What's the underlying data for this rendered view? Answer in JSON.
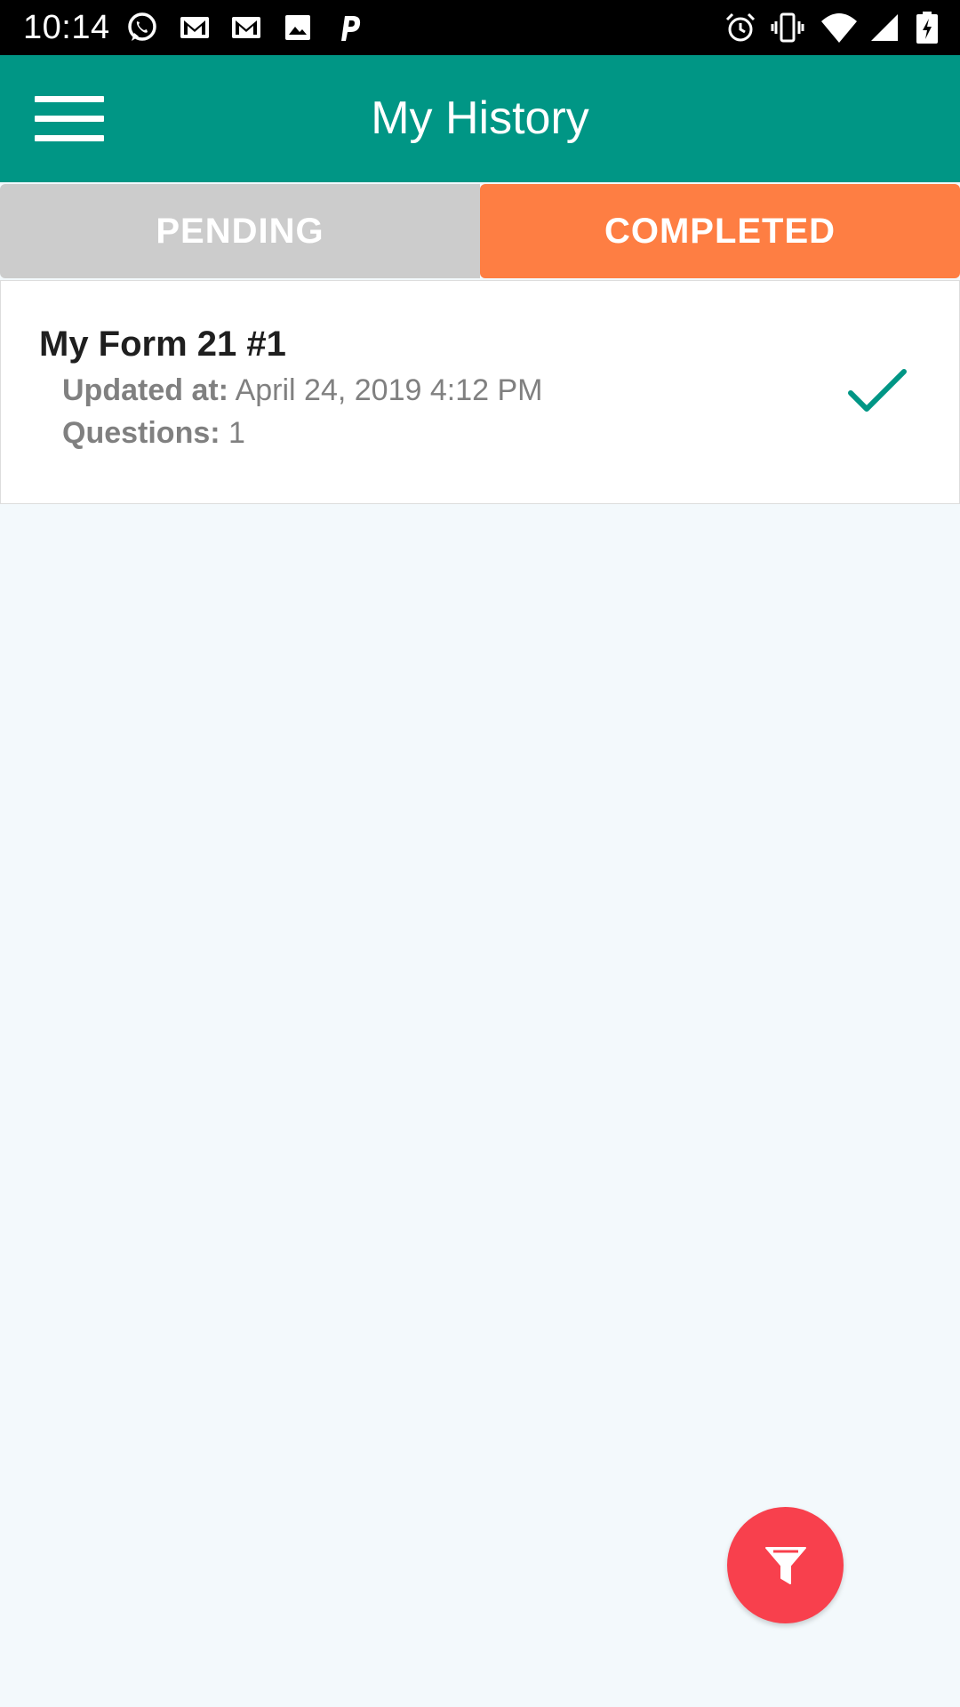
{
  "status_bar": {
    "time": "10:14",
    "left_icons": [
      "whatsapp-icon",
      "gmail-icon",
      "gmail-icon",
      "image-icon",
      "p-icon"
    ],
    "right_icons": [
      "alarm-icon",
      "vibrate-icon",
      "wifi-icon",
      "signal-icon",
      "battery-charging-icon"
    ]
  },
  "app_bar": {
    "title": "My History",
    "menu_icon": "hamburger-menu-icon",
    "color": "#009685"
  },
  "tabs": [
    {
      "label": "PENDING",
      "active": false,
      "color": "#cccccc"
    },
    {
      "label": "COMPLETED",
      "active": true,
      "color": "#fe7e43"
    }
  ],
  "history_items": [
    {
      "title": "My Form 21 #1",
      "updated_label": "Updated at:",
      "updated_value": "April 24, 2019 4:12 PM",
      "questions_label": "Questions:",
      "questions_value": "1",
      "status_icon": "checkmark-icon",
      "status_color": "#009685"
    }
  ],
  "fab": {
    "icon": "filter-icon",
    "color": "#f8404d"
  }
}
